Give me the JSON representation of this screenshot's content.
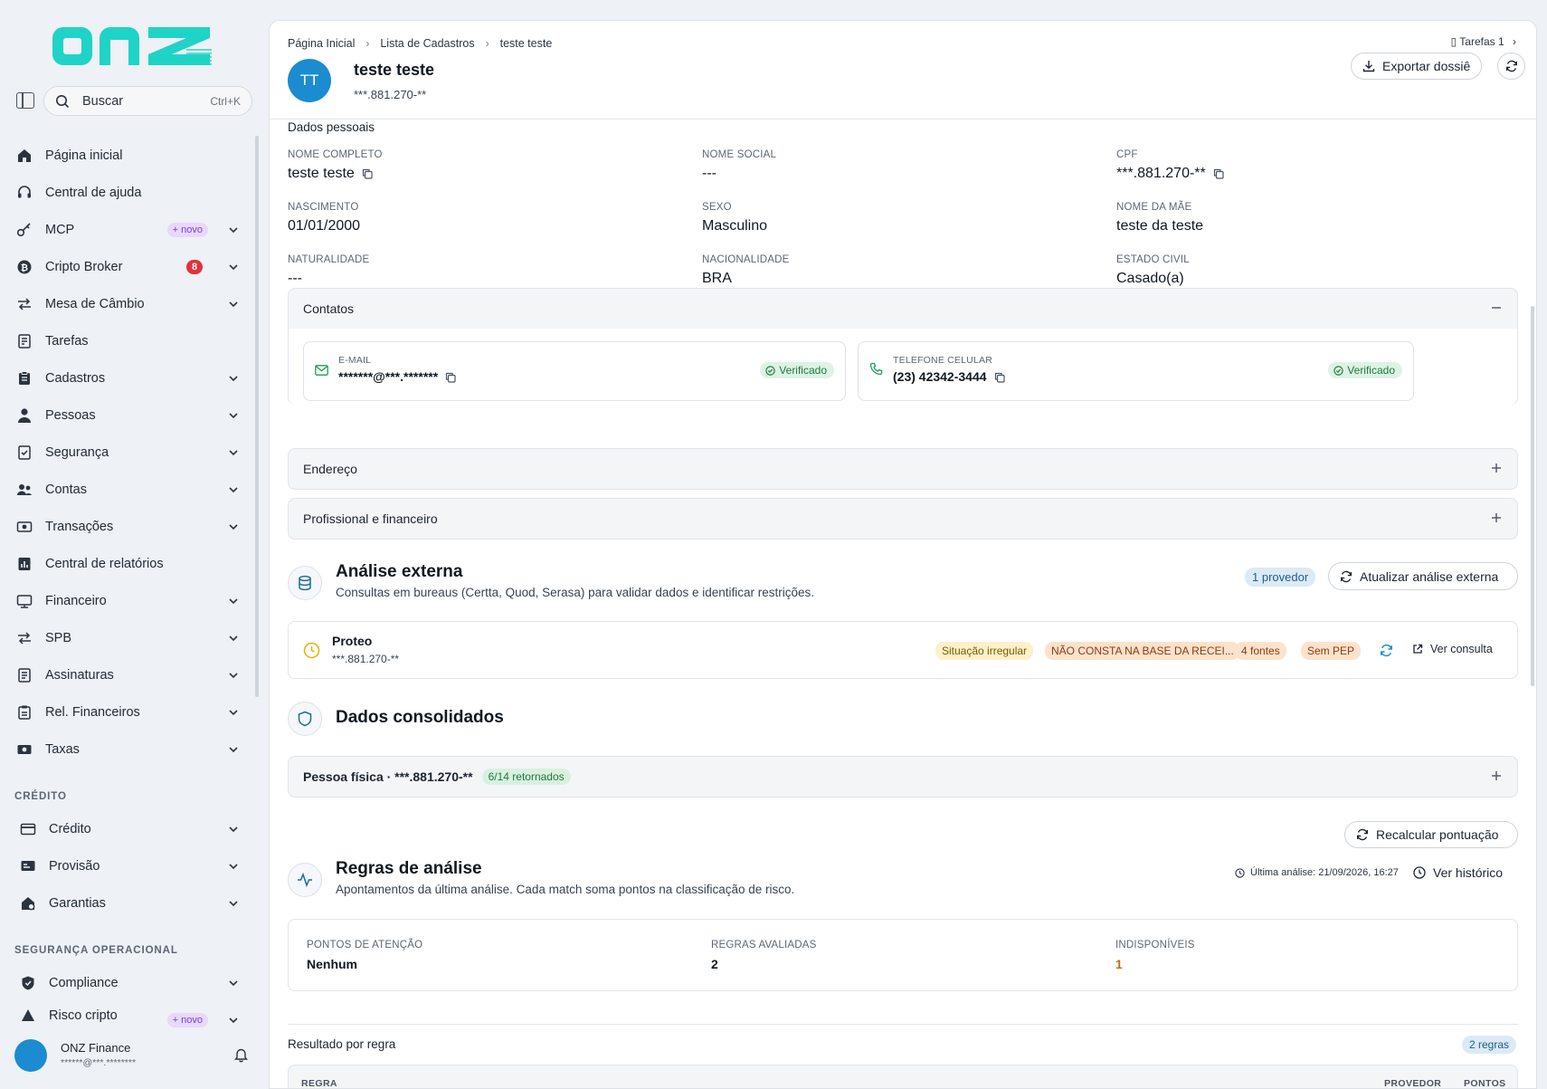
{
  "brand": {
    "logo_text": "onz",
    "accent": "#1fd3c6"
  },
  "search": {
    "label": "Buscar",
    "shortcut": "Ctrl+K"
  },
  "sidebar": {
    "items": [
      {
        "label": "Página inicial",
        "icon": "home-icon",
        "chevron": false
      },
      {
        "label": "Central de ajuda",
        "icon": "headset-icon",
        "chevron": false
      },
      {
        "label": "MCP",
        "icon": "key-icon",
        "chevron": true,
        "badge": "+ novo"
      },
      {
        "label": "Cripto Broker",
        "icon": "bitcoin-icon",
        "chevron": true,
        "count": "8"
      },
      {
        "label": "Mesa de Câmbio",
        "icon": "exchange-icon",
        "chevron": true
      },
      {
        "label": "Tarefas",
        "icon": "tasks-icon",
        "chevron": false
      },
      {
        "label": "Cadastros",
        "icon": "clipboard-icon",
        "chevron": true
      },
      {
        "label": "Pessoas",
        "icon": "person-icon",
        "chevron": true
      },
      {
        "label": "Segurança",
        "icon": "shield-check-icon",
        "chevron": true
      },
      {
        "label": "Contas",
        "icon": "users-icon",
        "chevron": true
      },
      {
        "label": "Transações",
        "icon": "money-icon",
        "chevron": true
      },
      {
        "label": "Central de relatórios",
        "icon": "report-icon",
        "chevron": false
      },
      {
        "label": "Financeiro",
        "icon": "finance-icon",
        "chevron": true
      },
      {
        "label": "SPB",
        "icon": "transfer-icon",
        "chevron": true
      },
      {
        "label": "Assinaturas",
        "icon": "signature-icon",
        "chevron": true
      },
      {
        "label": "Rel. Financeiros",
        "icon": "clipboard-list-icon",
        "chevron": true
      },
      {
        "label": "Taxas",
        "icon": "cash-icon",
        "chevron": true
      }
    ],
    "credit_section": "CRÉDITO",
    "credit_items": [
      {
        "label": "Crédito",
        "icon": "card-icon"
      },
      {
        "label": "Provisão",
        "icon": "provision-icon"
      },
      {
        "label": "Garantias",
        "icon": "guarantee-icon"
      }
    ],
    "ops_section": "SEGURANÇA OPERACIONAL",
    "ops_items": [
      {
        "label": "Compliance",
        "icon": "shield-icon"
      },
      {
        "label": "Risco cripto",
        "icon": "risk-icon",
        "badge": "+ novo"
      }
    ],
    "user": {
      "name": "ONZ Finance",
      "email": "******@***.********"
    }
  },
  "breadcrumb": [
    "Página Inicial",
    "Lista de Cadastros",
    "teste teste"
  ],
  "tasks_link": "Tarefas 1",
  "person": {
    "initials": "TT",
    "name": "teste teste",
    "cpf": "***.881.270-**"
  },
  "actions": {
    "export": "Exportar dossiê"
  },
  "personal": {
    "title": "Dados pessoais",
    "fields": [
      {
        "label": "NOME COMPLETO",
        "value": "teste teste",
        "copy": true
      },
      {
        "label": "NOME SOCIAL",
        "value": "---"
      },
      {
        "label": "CPF",
        "value": "***.881.270-**",
        "copy": true
      },
      {
        "label": "NASCIMENTO",
        "value": "01/01/2000"
      },
      {
        "label": "SEXO",
        "value": "Masculino"
      },
      {
        "label": "NOME DA MÃE",
        "value": "teste da teste"
      },
      {
        "label": "NATURALIDADE",
        "value": "---"
      },
      {
        "label": "NACIONALIDADE",
        "value": "BRA"
      },
      {
        "label": "ESTADO CIVIL",
        "value": "Casado(a)"
      }
    ]
  },
  "contacts": {
    "title": "Contatos",
    "email": {
      "label": "E-MAIL",
      "value": "*******@***.*******",
      "status": "Verificado"
    },
    "phone": {
      "label": "TELEFONE CELULAR",
      "value": "(23) 42342-3444",
      "status": "Verificado"
    }
  },
  "address": {
    "title": "Endereço"
  },
  "professional": {
    "title": "Profissional e financeiro"
  },
  "external": {
    "title": "Análise externa",
    "subtitle": "Consultas em bureaus (Certta, Quod, Serasa) para validar dados e identificar restrições.",
    "providers": "1 provedor",
    "update": "Atualizar análise externa",
    "result": {
      "name": "Proteo",
      "doc": "***.881.270-**",
      "tags": [
        "Situação irregular",
        "NÃO CONSTA NA BASE DA RECEI...",
        "4 fontes",
        "Sem PEP"
      ],
      "view": "Ver consulta"
    }
  },
  "consolidated": {
    "title": "Dados consolidados",
    "row": "Pessoa física · ***.881.270-**",
    "returned": "6/14 retornados"
  },
  "rules": {
    "recalc": "Recalcular pontuação",
    "title": "Regras de análise",
    "subtitle": "Apontamentos da última análise. Cada match soma pontos na classificação de risco.",
    "last": "Última análise: 21/09/2026, 16:27",
    "history": "Ver histórico",
    "metrics": [
      {
        "label": "PONTOS DE ATENÇÃO",
        "value": "Nenhum"
      },
      {
        "label": "REGRAS AVALIADAS",
        "value": "2"
      },
      {
        "label": "INDISPONÍVEIS",
        "value": "1"
      }
    ],
    "result_title": "Resultado por regra",
    "count": "2 regras",
    "columns": [
      "REGRA",
      "PROVEDOR",
      "PONTOS"
    ]
  }
}
